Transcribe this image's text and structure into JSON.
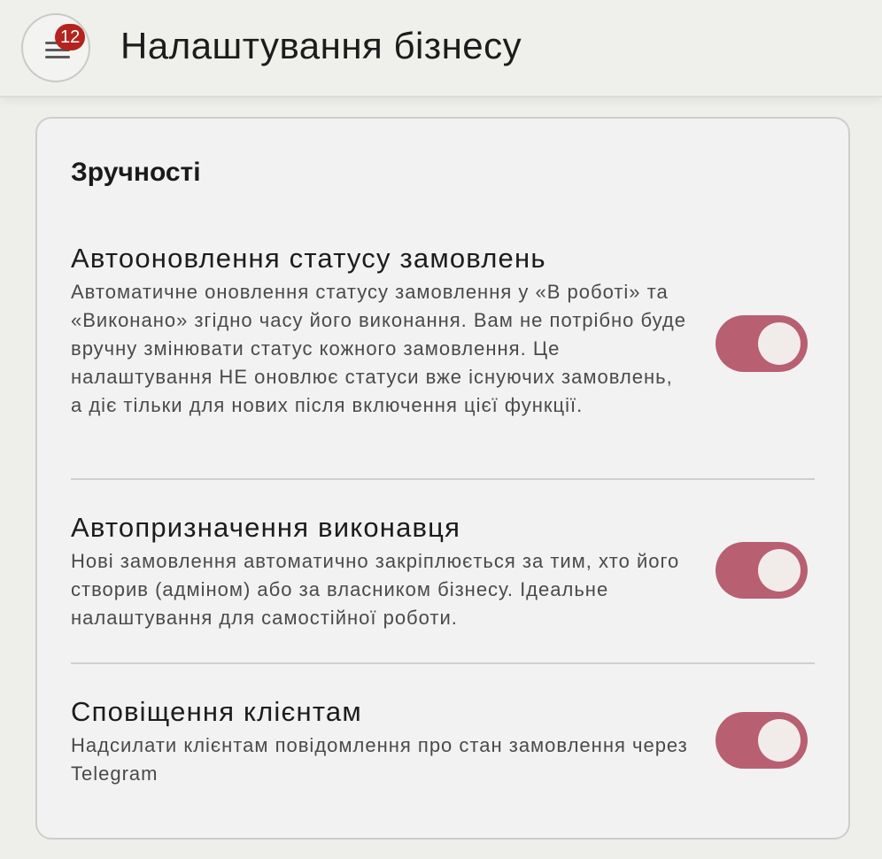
{
  "header": {
    "title": "Налаштування бізнесу",
    "menu_icon": "hamburger-menu-icon",
    "badge_count": "12",
    "badge_color": "#b3241f"
  },
  "section": {
    "title": "Зручності",
    "settings": [
      {
        "title": "Автооновлення статусу замовлень",
        "description": "Автоматичне оновлення статусу замовлення у «В роботі» та «Виконано» згідно часу його виконання. Вам не потрібно буде вручну змінювати статус кожного замовлення. Це налаштування НЕ оновлює статуси вже існуючих замовлень, а діє тільки для нових після включення цієї функції.",
        "enabled": true
      },
      {
        "title": "Автопризначення виконавця",
        "description": "Нові замовлення автоматично закріплюється за тим, хто його створив (адміном) або за власником бізнесу. Ідеальне налаштування для самостійної роботи.",
        "enabled": true
      },
      {
        "title": "Сповіщення клієнтам",
        "description": "Надсилати клієнтам повідомлення про стан замовлення через Telegram",
        "enabled": true
      }
    ]
  },
  "colors": {
    "toggle_on": "#b85f72",
    "toggle_knob": "#f1ece9"
  }
}
